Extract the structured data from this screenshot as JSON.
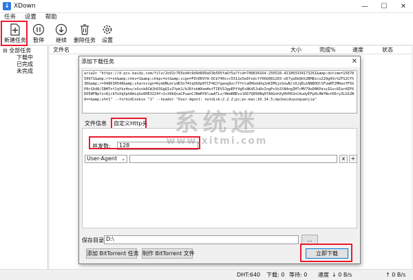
{
  "app": {
    "title": "XDown"
  },
  "menu": [
    "任务",
    "设置",
    "帮助"
  ],
  "toolbar": {
    "new_task": "新建任务",
    "pause": "暂停",
    "resume": "继续",
    "delete": "删除任务",
    "settings": "设置"
  },
  "sidebar": {
    "root": "全部任务",
    "items": [
      "下载中",
      "已完成",
      "未完成"
    ]
  },
  "list": {
    "columns": [
      "文件名",
      "大小",
      "完成%",
      "速度",
      "状态"
    ]
  },
  "status": {
    "dht": "DHT:640",
    "download": "下载: 0",
    "waiting": "等待: 0",
    "speed": "速度",
    "down_speed": "↓ 0 B/s",
    "up_speed": "↑ 0 B/s"
  },
  "dialog": {
    "title": "添加下载任务",
    "url_text": "aria2c \"https://d.pcs.baidu.com/file/2e91c765ed4c9d9d899a53b505fa6f5a?fid=740834164-250528-421003334173261&amp;dstime=1567850971&amp;rt=sh&amp;chkv=1&amp;chkpc=et&amp;sign=FDtERVYA-DCb740ccc5511e5e8fedcff06b081203-o67yp8kQb%2BM8zcs229g9Vc%2FS2CY%3D&amp;r=948630548&amp;sharesign=KymUNLmrydD3sT4tqUG6p0TCF4QJfgaog8zc7fYnla0HGebDq2eKIMGjeSnwB/s9jqEuiNN8OQlSFuwBF2MOwxYF5GP0cSXd8/IBHTnfJqYkzHsu/oXvxk8CWJhD3GgQ1vZfpb1/bJDfebWXemHufTIEV3JgpEPfVgE+8Kd5JuRxIngPsSh3lN4ngZHTcMV79eD0KPd+yIGvc8IarHZF6DO5WFNpfz+8jcbTeXqXph0mLqSe6HE3Z24f+1cX0bQxaCPuanCJBmHY8luwATLz/0WaRBEvz1667Q09XBq07A6GnhXyHVHSSnCAudyEFp6LHWfNxtK6ry3LGS2NA==&amp;sh=1\" --forbidCookie \"1\" --header \"User-Agent: netdisk;2.2.2;pc;pc-mac;10.14.5;macbaiduyunguanjia\"",
    "tab_info": "文件信息",
    "tab_custom": "自定义Http头",
    "concurrency_label": "并发数:",
    "concurrency_value": "128",
    "header_key": "User-Agent",
    "header_value": "",
    "remove_btn": "x",
    "add_btn": "+",
    "save_dir_label": "保存目录",
    "save_dir_value": "D:\\",
    "browse_btn": "...",
    "add_bt_btn": "添加 BitTorrent 任务",
    "make_bt_btn": "制作 BitTorrent 文件",
    "download_btn": "立即下载"
  },
  "watermark": {
    "text": "系统迷",
    "sub": "www.xitmi.com"
  },
  "colors": {
    "highlight": "#e8192c",
    "accent": "#2a7ae2"
  }
}
